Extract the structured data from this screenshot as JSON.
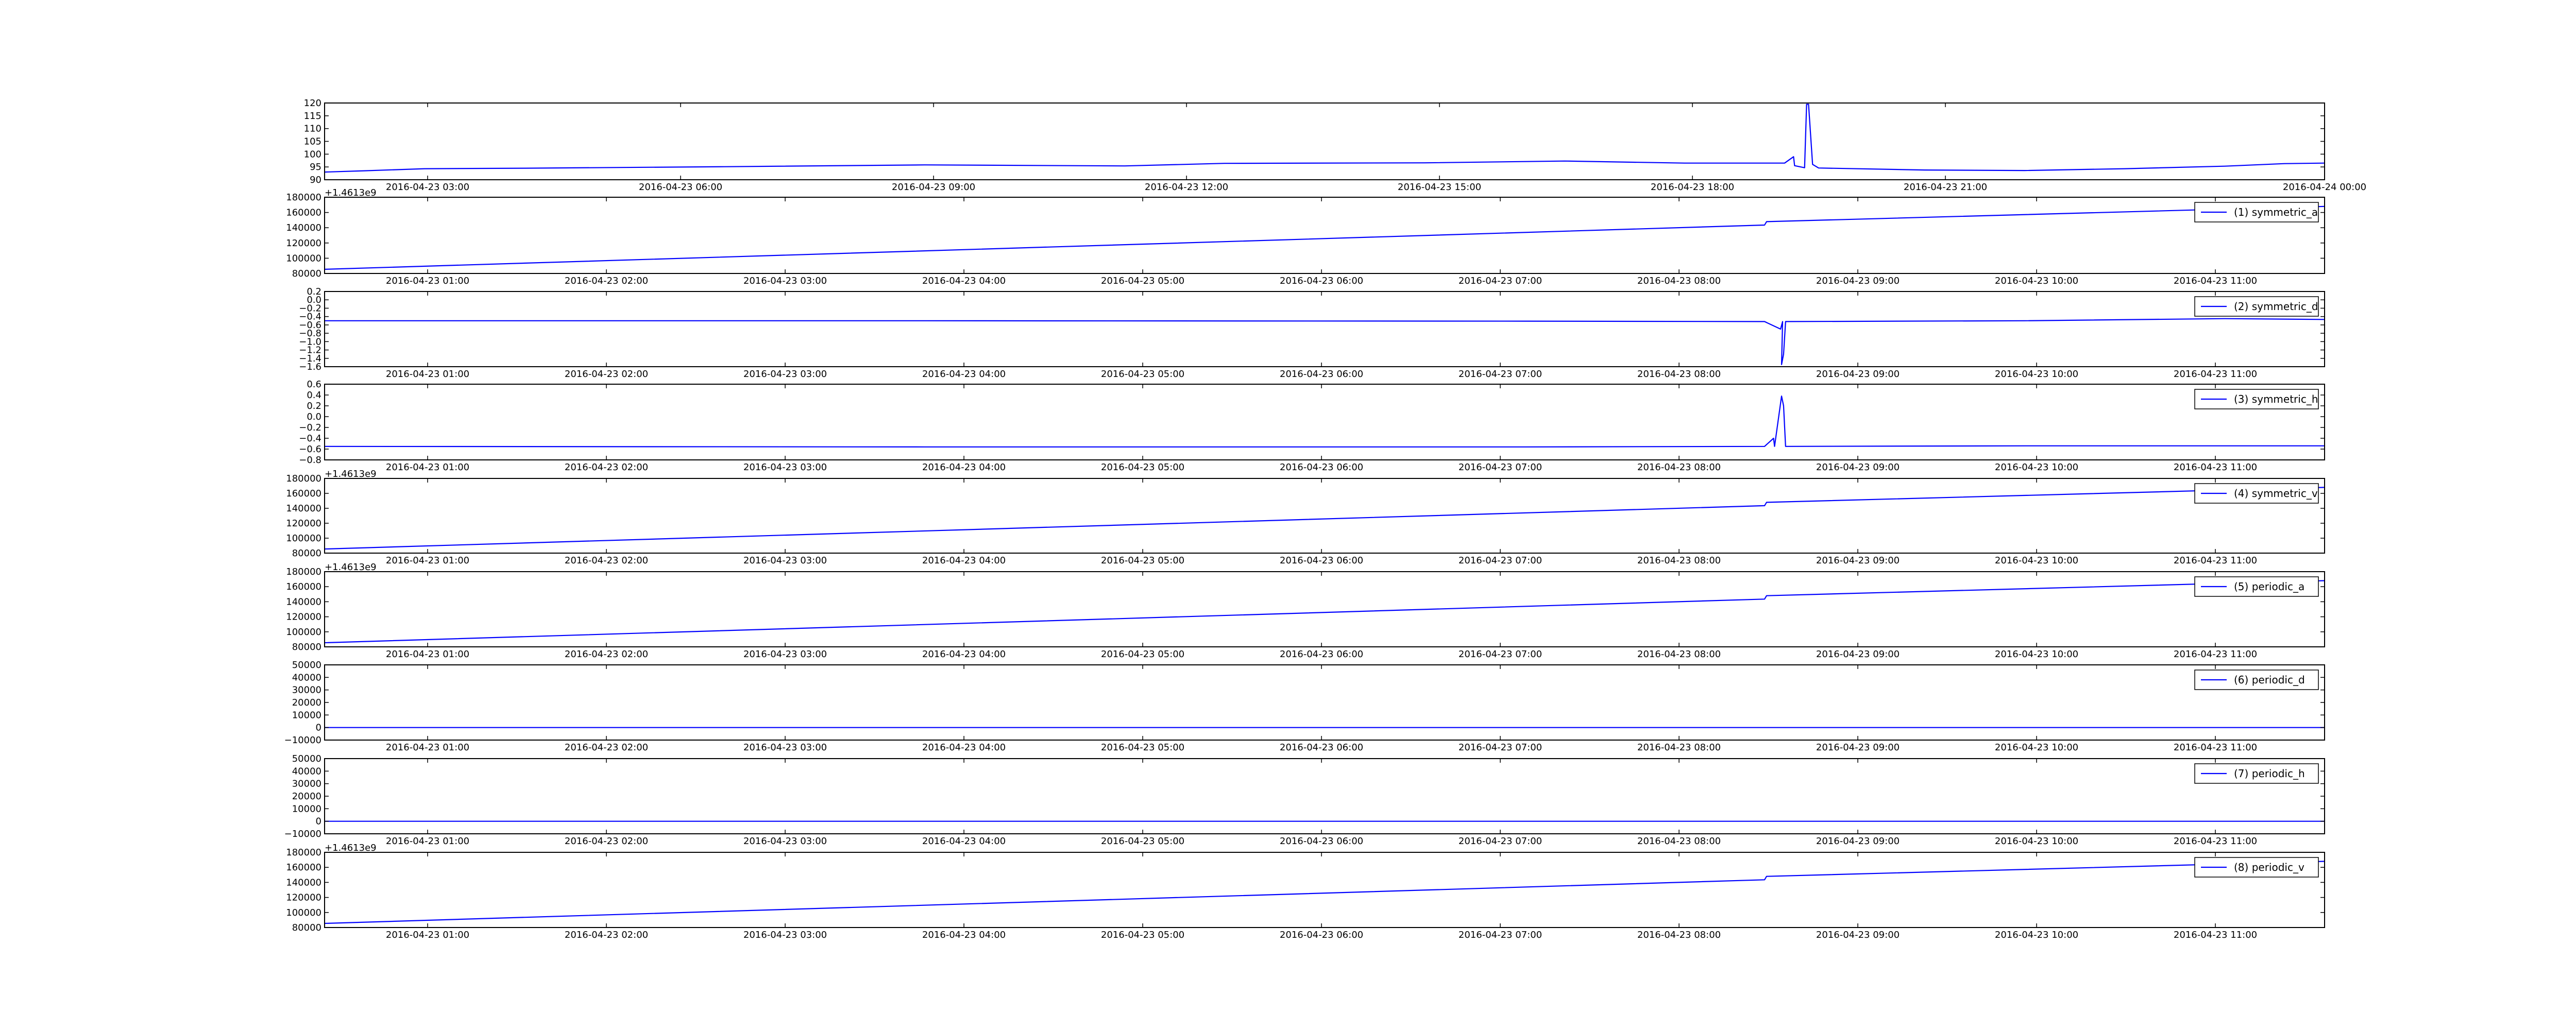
{
  "figure": {
    "background": "#ffffff",
    "line_color": "#0000ff",
    "legend_location": "upper right"
  },
  "chart_data": [
    {
      "type": "line",
      "series": [
        {
          "values": [
            [
              0,
              93.0
            ],
            [
              0.02,
              93.5
            ],
            [
              0.05,
              94.3
            ],
            [
              0.1,
              94.5
            ],
            [
              0.2,
              95.1
            ],
            [
              0.3,
              95.8
            ],
            [
              0.4,
              95.4
            ],
            [
              0.45,
              96.4
            ],
            [
              0.55,
              96.6
            ],
            [
              0.62,
              97.3
            ],
            [
              0.68,
              96.5
            ],
            [
              0.7,
              96.5
            ],
            [
              0.73,
              96.5
            ],
            [
              0.7345,
              99.0
            ],
            [
              0.735,
              95.5
            ],
            [
              0.74,
              94.7
            ],
            [
              0.741,
              119.5
            ],
            [
              0.742,
              119.5
            ],
            [
              0.744,
              96.0
            ],
            [
              0.747,
              94.6
            ],
            [
              0.8,
              93.8
            ],
            [
              0.85,
              93.6
            ],
            [
              0.9,
              94.3
            ],
            [
              0.95,
              95.3
            ],
            [
              0.98,
              96.3
            ],
            [
              1,
              96.5
            ]
          ]
        }
      ],
      "x_ticks": [
        "2016-04-23 03:00",
        "2016-04-23 06:00",
        "2016-04-23 09:00",
        "2016-04-23 12:00",
        "2016-04-23 15:00",
        "2016-04-23 18:00",
        "2016-04-23 21:00",
        "2016-04-24 00:00"
      ],
      "y_ticks": [
        "90",
        "95",
        "100",
        "105",
        "110",
        "115",
        "120"
      ],
      "ylim": [
        90,
        120
      ],
      "y_offset_text": "",
      "grid": false
    },
    {
      "type": "line",
      "series": [
        {
          "name": "(1) symmetric_a",
          "values": [
            [
              0,
              85500
            ],
            [
              0.72,
              143500
            ],
            [
              0.721,
              148000
            ],
            [
              1,
              168000
            ]
          ]
        }
      ],
      "x_ticks": [
        "2016-04-23 01:00",
        "2016-04-23 02:00",
        "2016-04-23 03:00",
        "2016-04-23 04:00",
        "2016-04-23 05:00",
        "2016-04-23 06:00",
        "2016-04-23 07:00",
        "2016-04-23 08:00",
        "2016-04-23 09:00",
        "2016-04-23 10:00",
        "2016-04-23 11:00"
      ],
      "y_ticks": [
        "80000",
        "100000",
        "120000",
        "140000",
        "160000",
        "180000"
      ],
      "ylim": [
        80000,
        180000
      ],
      "y_offset_text": "+1.4613e9",
      "grid": false
    },
    {
      "type": "line",
      "series": [
        {
          "name": "(2) symmetric_d",
          "values": [
            [
              0,
              -0.5
            ],
            [
              0.3,
              -0.5
            ],
            [
              0.6,
              -0.51
            ],
            [
              0.72,
              -0.52
            ],
            [
              0.728,
              -0.7
            ],
            [
              0.729,
              -0.52
            ],
            [
              0.7285,
              -1.55
            ],
            [
              0.7295,
              -1.3
            ],
            [
              0.7305,
              -0.52
            ],
            [
              0.85,
              -0.5
            ],
            [
              0.95,
              -0.45
            ],
            [
              1,
              -0.47
            ]
          ]
        }
      ],
      "x_ticks": [
        "2016-04-23 01:00",
        "2016-04-23 02:00",
        "2016-04-23 03:00",
        "2016-04-23 04:00",
        "2016-04-23 05:00",
        "2016-04-23 06:00",
        "2016-04-23 07:00",
        "2016-04-23 08:00",
        "2016-04-23 09:00",
        "2016-04-23 10:00",
        "2016-04-23 11:00"
      ],
      "y_ticks": [
        "−1.6",
        "−1.4",
        "−1.2",
        "−1.0",
        "−0.8",
        "−0.6",
        "−0.4",
        "−0.2",
        "0.0",
        "0.2"
      ],
      "ylim": [
        -1.6,
        0.2
      ],
      "y_offset_text": "",
      "grid": false
    },
    {
      "type": "line",
      "series": [
        {
          "name": "(3) symmetric_h",
          "values": [
            [
              0,
              -0.55
            ],
            [
              0.3,
              -0.56
            ],
            [
              0.6,
              -0.56
            ],
            [
              0.72,
              -0.55
            ],
            [
              0.7245,
              -0.4
            ],
            [
              0.725,
              -0.55
            ],
            [
              0.7285,
              0.38
            ],
            [
              0.7295,
              0.2
            ],
            [
              0.7305,
              -0.55
            ],
            [
              0.85,
              -0.54
            ],
            [
              0.95,
              -0.54
            ],
            [
              1,
              -0.54
            ]
          ]
        }
      ],
      "x_ticks": [
        "2016-04-23 01:00",
        "2016-04-23 02:00",
        "2016-04-23 03:00",
        "2016-04-23 04:00",
        "2016-04-23 05:00",
        "2016-04-23 06:00",
        "2016-04-23 07:00",
        "2016-04-23 08:00",
        "2016-04-23 09:00",
        "2016-04-23 10:00",
        "2016-04-23 11:00"
      ],
      "y_ticks": [
        "−0.8",
        "−0.6",
        "−0.4",
        "−0.2",
        "0.0",
        "0.2",
        "0.4",
        "0.6"
      ],
      "ylim": [
        -0.8,
        0.6
      ],
      "y_offset_text": "",
      "grid": false
    },
    {
      "type": "line",
      "series": [
        {
          "name": "(4) symmetric_v",
          "values": [
            [
              0,
              85500
            ],
            [
              0.72,
              143500
            ],
            [
              0.721,
              148000
            ],
            [
              1,
              168000
            ]
          ]
        }
      ],
      "x_ticks": [
        "2016-04-23 01:00",
        "2016-04-23 02:00",
        "2016-04-23 03:00",
        "2016-04-23 04:00",
        "2016-04-23 05:00",
        "2016-04-23 06:00",
        "2016-04-23 07:00",
        "2016-04-23 08:00",
        "2016-04-23 09:00",
        "2016-04-23 10:00",
        "2016-04-23 11:00"
      ],
      "y_ticks": [
        "80000",
        "100000",
        "120000",
        "140000",
        "160000",
        "180000"
      ],
      "ylim": [
        80000,
        180000
      ],
      "y_offset_text": "+1.4613e9",
      "grid": false
    },
    {
      "type": "line",
      "series": [
        {
          "name": "(5) periodic_a",
          "values": [
            [
              0,
              85500
            ],
            [
              0.72,
              143500
            ],
            [
              0.721,
              148000
            ],
            [
              1,
              168000
            ]
          ]
        }
      ],
      "x_ticks": [
        "2016-04-23 01:00",
        "2016-04-23 02:00",
        "2016-04-23 03:00",
        "2016-04-23 04:00",
        "2016-04-23 05:00",
        "2016-04-23 06:00",
        "2016-04-23 07:00",
        "2016-04-23 08:00",
        "2016-04-23 09:00",
        "2016-04-23 10:00",
        "2016-04-23 11:00"
      ],
      "y_ticks": [
        "80000",
        "100000",
        "120000",
        "140000",
        "160000",
        "180000"
      ],
      "ylim": [
        80000,
        180000
      ],
      "y_offset_text": "+1.4613e9",
      "grid": false
    },
    {
      "type": "line",
      "series": [
        {
          "name": "(6) periodic_d",
          "values": [
            [
              0,
              0
            ],
            [
              1,
              0
            ]
          ]
        }
      ],
      "x_ticks": [
        "2016-04-23 01:00",
        "2016-04-23 02:00",
        "2016-04-23 03:00",
        "2016-04-23 04:00",
        "2016-04-23 05:00",
        "2016-04-23 06:00",
        "2016-04-23 07:00",
        "2016-04-23 08:00",
        "2016-04-23 09:00",
        "2016-04-23 10:00",
        "2016-04-23 11:00"
      ],
      "y_ticks": [
        "−10000",
        "0",
        "10000",
        "20000",
        "30000",
        "40000",
        "50000"
      ],
      "ylim": [
        -10000,
        50000
      ],
      "y_offset_text": "",
      "grid": false
    },
    {
      "type": "line",
      "series": [
        {
          "name": "(7) periodic_h",
          "values": [
            [
              0,
              0
            ],
            [
              1,
              0
            ]
          ]
        }
      ],
      "x_ticks": [
        "2016-04-23 01:00",
        "2016-04-23 02:00",
        "2016-04-23 03:00",
        "2016-04-23 04:00",
        "2016-04-23 05:00",
        "2016-04-23 06:00",
        "2016-04-23 07:00",
        "2016-04-23 08:00",
        "2016-04-23 09:00",
        "2016-04-23 10:00",
        "2016-04-23 11:00"
      ],
      "y_ticks": [
        "−10000",
        "0",
        "10000",
        "20000",
        "30000",
        "40000",
        "50000"
      ],
      "ylim": [
        -10000,
        50000
      ],
      "y_offset_text": "",
      "grid": false
    },
    {
      "type": "line",
      "series": [
        {
          "name": "(8) periodic_v",
          "values": [
            [
              0,
              85500
            ],
            [
              0.72,
              143500
            ],
            [
              0.721,
              148000
            ],
            [
              1,
              168000
            ]
          ]
        }
      ],
      "x_ticks": [
        "2016-04-23 01:00",
        "2016-04-23 02:00",
        "2016-04-23 03:00",
        "2016-04-23 04:00",
        "2016-04-23 05:00",
        "2016-04-23 06:00",
        "2016-04-23 07:00",
        "2016-04-23 08:00",
        "2016-04-23 09:00",
        "2016-04-23 10:00",
        "2016-04-23 11:00"
      ],
      "y_ticks": [
        "80000",
        "100000",
        "120000",
        "140000",
        "160000",
        "180000"
      ],
      "ylim": [
        80000,
        180000
      ],
      "y_offset_text": "+1.4613e9",
      "grid": false
    }
  ]
}
